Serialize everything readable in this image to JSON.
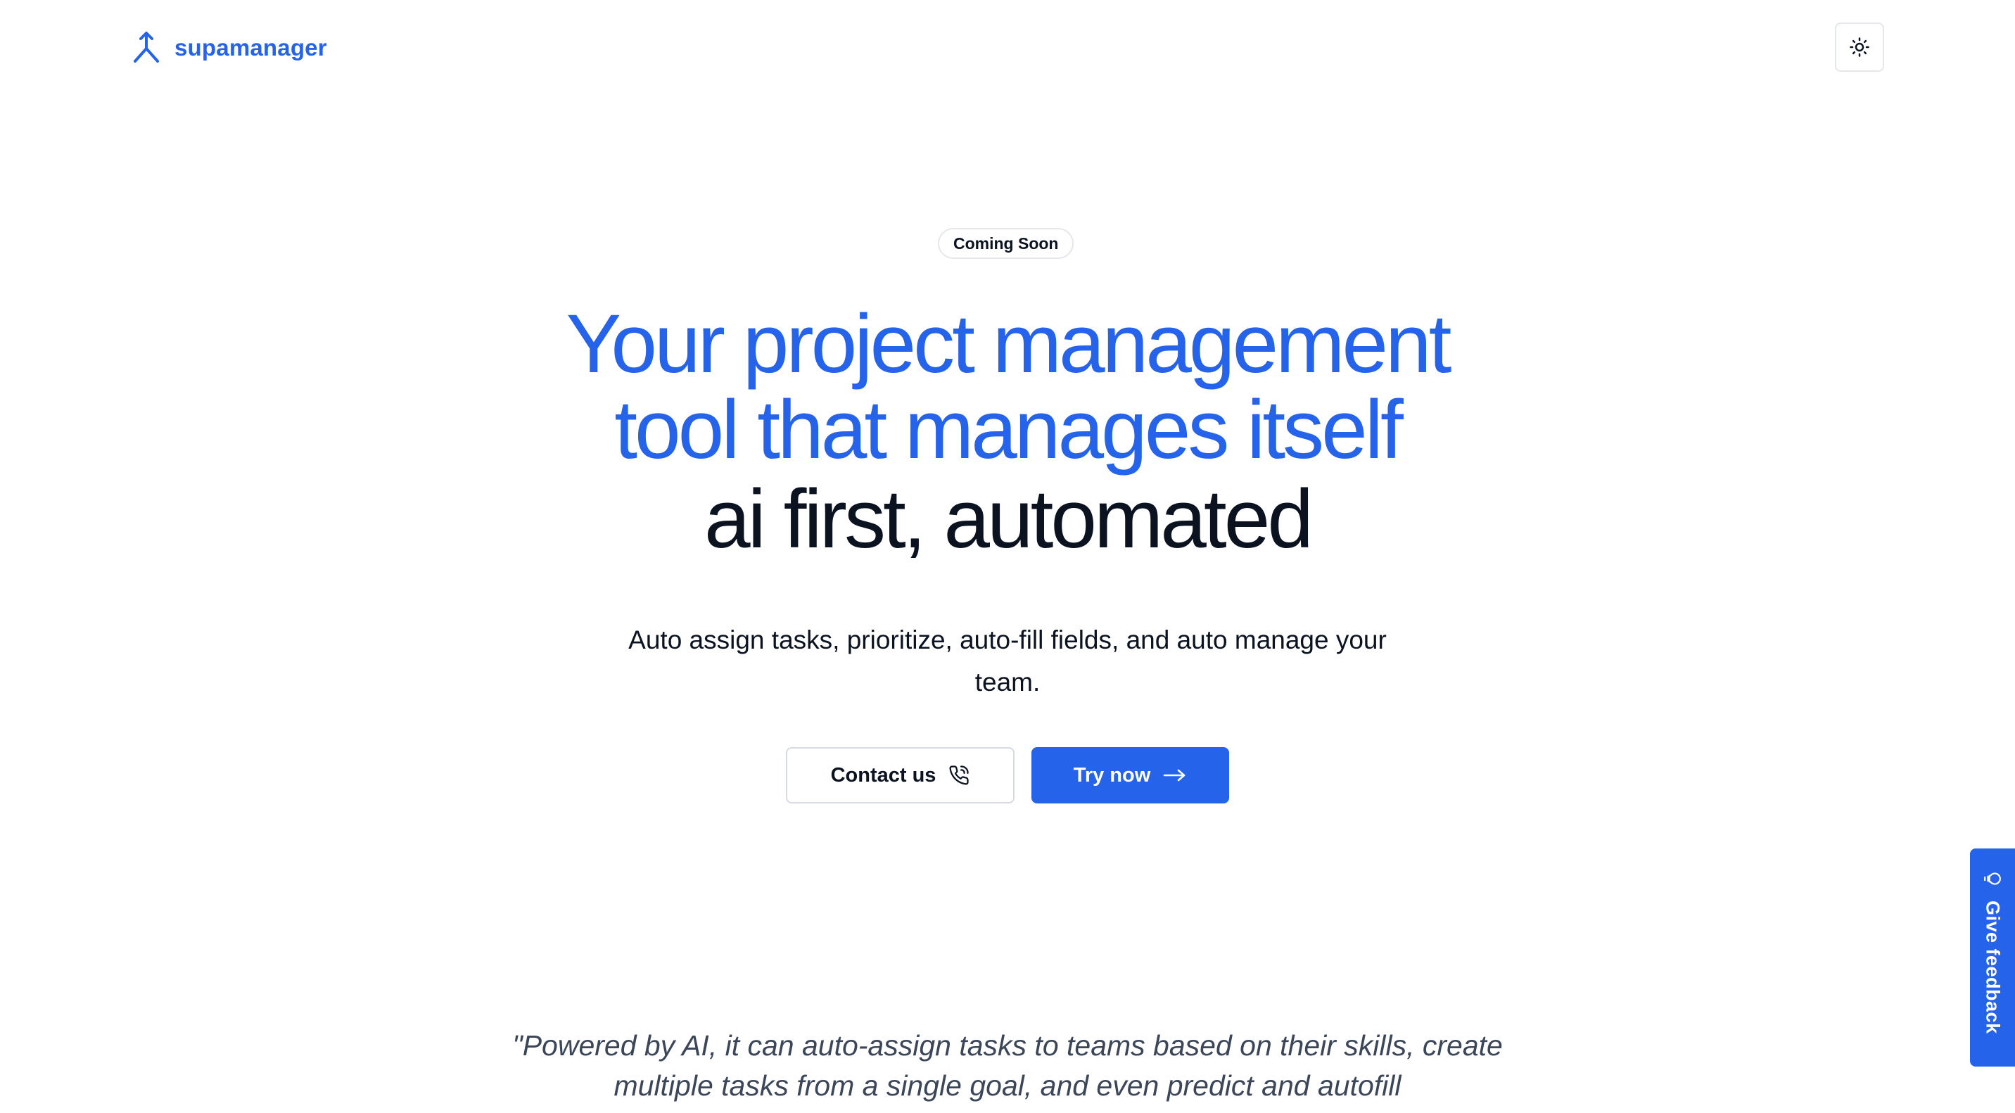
{
  "header": {
    "brand_name": "supamanager",
    "logo_icon": "merge-arrow-icon",
    "theme_toggle_icon": "sun-icon"
  },
  "hero": {
    "badge": "Coming Soon",
    "headline_line1": "Your project management",
    "headline_line2": "tool that manages itself",
    "headline_line3": "ai first, automated",
    "subtitle": "Auto assign tasks, prioritize, auto-fill fields, and auto manage your team.",
    "contact_button": "Contact us",
    "contact_icon": "phone-icon",
    "try_button": "Try now",
    "try_icon": "arrow-right-icon"
  },
  "quote": {
    "text": "\"Powered by AI, it can auto-assign tasks to teams based on their skills, create multiple tasks from a single goal, and even predict and autofill"
  },
  "feedback": {
    "label": "Give feedback",
    "icon": "lightbulb-icon"
  },
  "colors": {
    "accent": "#2563eb",
    "text": "#0b1220",
    "muted": "#3b4658",
    "border": "#e5e7eb"
  }
}
